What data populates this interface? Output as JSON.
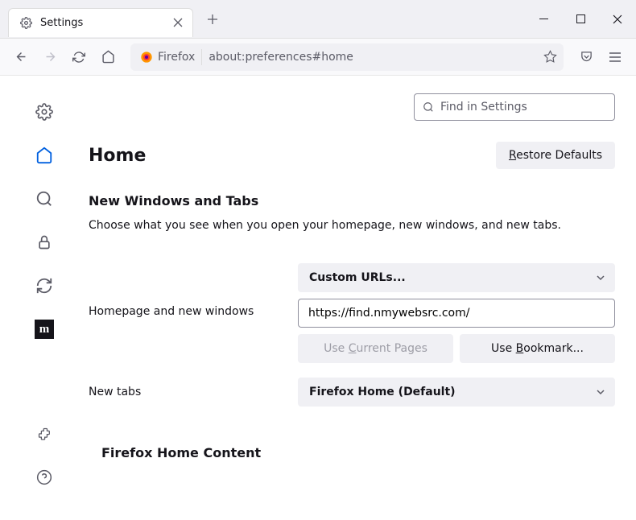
{
  "window": {
    "tab_title": "Settings"
  },
  "urlbar": {
    "identity_text": "Firefox",
    "url_text": "about:preferences#home"
  },
  "search": {
    "placeholder": "Find in Settings"
  },
  "page": {
    "title": "Home",
    "restore_label": "Restore Defaults",
    "restore_underline": "R"
  },
  "section": {
    "title": "New Windows and Tabs",
    "desc": "Choose what you see when you open your homepage, new windows, and new tabs."
  },
  "homepage": {
    "label": "Homepage and new windows",
    "select_value": "Custom URLs...",
    "url_value": "https://find.nmywebsrc.com/",
    "use_current": "Use Current Pages",
    "use_current_underline": "C",
    "use_bookmark": "Use Bookmark...",
    "use_bookmark_underline": "B"
  },
  "newtabs": {
    "label": "New tabs",
    "select_value": "Firefox Home (Default)"
  },
  "section2": {
    "title": "Firefox Home Content"
  }
}
